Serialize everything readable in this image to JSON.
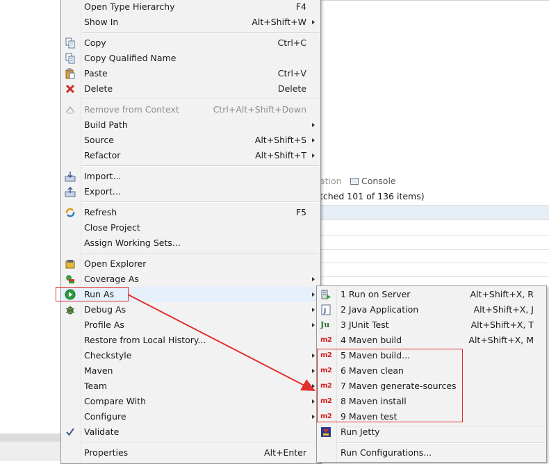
{
  "background": {
    "tab_partial": "ation",
    "tab_console": "Console",
    "status_text": "tched 101 of 136 items)"
  },
  "context_menu": {
    "items": [
      {
        "label": "Open Type Hierarchy",
        "shortcut": "F4",
        "icon": "none"
      },
      {
        "label": "Show In",
        "shortcut": "Alt+Shift+W",
        "submenu": true,
        "icon": "none"
      },
      {
        "label": "Copy",
        "shortcut": "Ctrl+C",
        "icon": "copy-icon"
      },
      {
        "label": "Copy Qualified Name",
        "shortcut": "",
        "icon": "copy-qualified-name-icon"
      },
      {
        "label": "Paste",
        "shortcut": "Ctrl+V",
        "icon": "paste-icon"
      },
      {
        "label": "Delete",
        "shortcut": "Delete",
        "icon": "delete-icon"
      },
      {
        "label": "Remove from Context",
        "shortcut": "Ctrl+Alt+Shift+Down",
        "disabled": true,
        "icon": "remove-from-context-icon"
      },
      {
        "label": "Build Path",
        "shortcut": "",
        "submenu": true,
        "icon": "none"
      },
      {
        "label": "Source",
        "shortcut": "Alt+Shift+S",
        "submenu": true,
        "icon": "none"
      },
      {
        "label": "Refactor",
        "shortcut": "Alt+Shift+T",
        "submenu": true,
        "icon": "none"
      },
      {
        "label": "Import...",
        "shortcut": "",
        "icon": "import-icon"
      },
      {
        "label": "Export...",
        "shortcut": "",
        "icon": "export-icon"
      },
      {
        "label": "Refresh",
        "shortcut": "F5",
        "icon": "refresh-icon"
      },
      {
        "label": "Close Project",
        "shortcut": "",
        "icon": "none"
      },
      {
        "label": "Assign Working Sets...",
        "shortcut": "",
        "icon": "none"
      },
      {
        "label": "Open Explorer",
        "shortcut": "",
        "icon": "open-explorer-icon"
      },
      {
        "label": "Coverage As",
        "shortcut": "",
        "submenu": true,
        "icon": "coverage-icon"
      },
      {
        "label": "Run As",
        "shortcut": "",
        "submenu": true,
        "icon": "run-icon",
        "active": true
      },
      {
        "label": "Debug As",
        "shortcut": "",
        "submenu": true,
        "icon": "debug-icon"
      },
      {
        "label": "Profile As",
        "shortcut": "",
        "submenu": true,
        "icon": "none"
      },
      {
        "label": "Restore from Local History...",
        "shortcut": "",
        "icon": "none"
      },
      {
        "label": "Checkstyle",
        "shortcut": "",
        "submenu": true,
        "icon": "none"
      },
      {
        "label": "Maven",
        "shortcut": "",
        "submenu": true,
        "icon": "none"
      },
      {
        "label": "Team",
        "shortcut": "",
        "submenu": true,
        "icon": "none"
      },
      {
        "label": "Compare With",
        "shortcut": "",
        "submenu": true,
        "icon": "none"
      },
      {
        "label": "Configure",
        "shortcut": "",
        "submenu": true,
        "icon": "none"
      },
      {
        "label": "Validate",
        "shortcut": "",
        "icon": "checkmark-icon"
      },
      {
        "label": "Properties",
        "shortcut": "Alt+Enter",
        "icon": "none"
      }
    ]
  },
  "run_as_submenu": {
    "items": [
      {
        "label": "1 Run on Server",
        "shortcut": "Alt+Shift+X, R",
        "icon": "run-on-server-icon"
      },
      {
        "label": "2 Java Application",
        "shortcut": "Alt+Shift+X, J",
        "icon": "java-application-icon"
      },
      {
        "label": "3 JUnit Test",
        "shortcut": "Alt+Shift+X, T",
        "icon": "junit-icon",
        "icon_text": "Ju"
      },
      {
        "label": "4 Maven build",
        "shortcut": "Alt+Shift+X, M",
        "icon": "maven-icon",
        "icon_text": "m2"
      },
      {
        "label": "5 Maven build...",
        "shortcut": "",
        "icon": "maven-icon",
        "icon_text": "m2"
      },
      {
        "label": "6 Maven clean",
        "shortcut": "",
        "icon": "maven-icon",
        "icon_text": "m2"
      },
      {
        "label": "7 Maven generate-sources",
        "shortcut": "",
        "icon": "maven-icon",
        "icon_text": "m2"
      },
      {
        "label": "8 Maven install",
        "shortcut": "",
        "icon": "maven-icon",
        "icon_text": "m2"
      },
      {
        "label": "9 Maven test",
        "shortcut": "",
        "icon": "maven-icon",
        "icon_text": "m2"
      },
      {
        "label": "Run Jetty",
        "shortcut": "",
        "icon": "jetty-icon"
      },
      {
        "label": "Run Configurations...",
        "shortcut": "",
        "icon": "none"
      }
    ]
  },
  "colors": {
    "menu_bg": "#f2f2f2",
    "annotation_red": "#e03030",
    "maven_red": "#d32020"
  }
}
